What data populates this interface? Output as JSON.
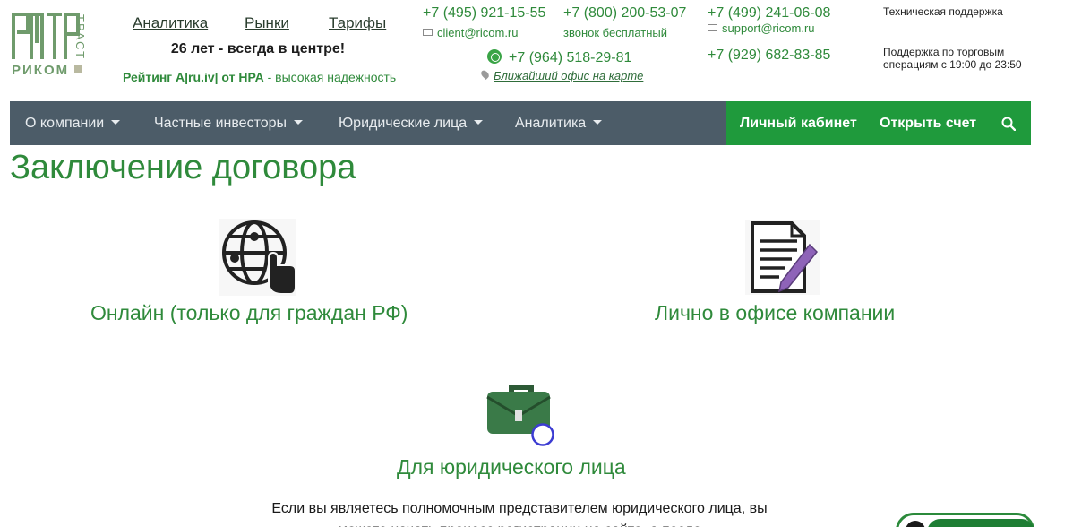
{
  "logo": {
    "word": "РИКОМ",
    "side": "ТРАСТ"
  },
  "topnav": [
    {
      "label": "Аналитика"
    },
    {
      "label": "Рынки"
    },
    {
      "label": "Тарифы"
    }
  ],
  "slogan": "26 лет - всегда в центре!",
  "rating": {
    "strong": "Рейтинг A|ru.iv| от НРА",
    "weak": " - высокая надежность"
  },
  "contacts": {
    "phone1": "+7 (495) 921-15-55",
    "email1": "client@ricom.ru",
    "phone2": "+7 (800) 200-53-07",
    "phone2_note": "звонок бесплатный",
    "phone3": "+7 (499) 241-06-08",
    "email3": "support@ricom.ru",
    "whatsapp": "+7 (964) 518-29-81",
    "office_link": "Ближайший офис на карте",
    "phone4": "+7 (929) 682-83-85"
  },
  "support": {
    "tech": "Техническая поддержка",
    "trade_1": "Поддержка по торговым",
    "trade_2": "операциям с 19:00 до 23:50"
  },
  "navbar": {
    "items": [
      {
        "label": "О компании"
      },
      {
        "label": "Частные инвесторы"
      },
      {
        "label": "Юридические лица"
      },
      {
        "label": "Аналитика"
      }
    ],
    "cabinet": "Личный кабинет",
    "open_account": "Открыть счет"
  },
  "page_title": "Заключение договора",
  "cards": {
    "online": "Онлайн (только для граждан РФ)",
    "office": "Лично в офисе компании",
    "legal": "Для юридического лица"
  },
  "intro": "Если вы являетесь полномочным представителем юридического лица, вы можете начать процесс регистрации на сайте, а после",
  "colors": {
    "brand_green": "#2f8a3b",
    "nav_bg": "#4c5c68",
    "nav_green": "#1f9a3c"
  }
}
